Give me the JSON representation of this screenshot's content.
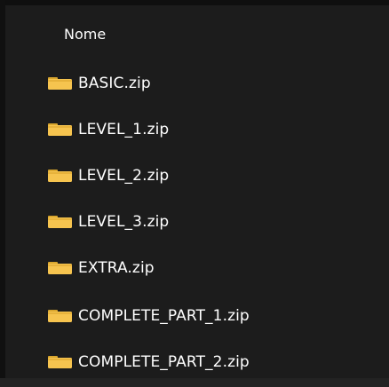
{
  "list": {
    "column_header": "Nome",
    "items": [
      {
        "name": "BASIC.zip",
        "icon": "folder-icon"
      },
      {
        "name": "LEVEL_1.zip",
        "icon": "folder-icon"
      },
      {
        "name": "LEVEL_2.zip",
        "icon": "folder-icon"
      },
      {
        "name": "LEVEL_3.zip",
        "icon": "folder-icon"
      },
      {
        "name": "EXTRA.zip",
        "icon": "folder-icon"
      },
      {
        "name": "COMPLETE_PART_1.zip",
        "icon": "folder-icon"
      },
      {
        "name": "COMPLETE_PART_2.zip",
        "icon": "folder-icon"
      }
    ]
  },
  "colors": {
    "background": "#1c1c1c",
    "text": "#ffffff",
    "folder": "#f6c44f",
    "folder_shadow": "#d9a62e"
  }
}
